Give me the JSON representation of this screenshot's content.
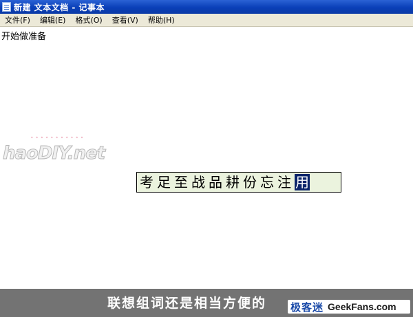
{
  "window": {
    "title": "新建 文本文档 - 记事本"
  },
  "menu": {
    "items": [
      {
        "label": "文件(F)"
      },
      {
        "label": "编辑(E)"
      },
      {
        "label": "格式(O)"
      },
      {
        "label": "查看(V)"
      },
      {
        "label": "帮助(H)"
      }
    ]
  },
  "editor": {
    "text": "开始做准备"
  },
  "ime": {
    "candidates": [
      "考",
      "足",
      "至",
      "战",
      "品",
      "耕",
      "份",
      "忘",
      "注",
      "用"
    ],
    "selected_index": 9
  },
  "watermark": {
    "text": "haoDIY.net"
  },
  "caption": {
    "text": "联想组词还是相当方便的"
  },
  "brand": {
    "cn": "极客迷",
    "en": "GeekFans.com"
  },
  "colors": {
    "titlebar": "#0a3fb8",
    "selection": "#0a246a",
    "ime_bg": "#ebf3de",
    "caption_bg": "#737373"
  },
  "icons": {
    "title": "notepad-icon"
  }
}
